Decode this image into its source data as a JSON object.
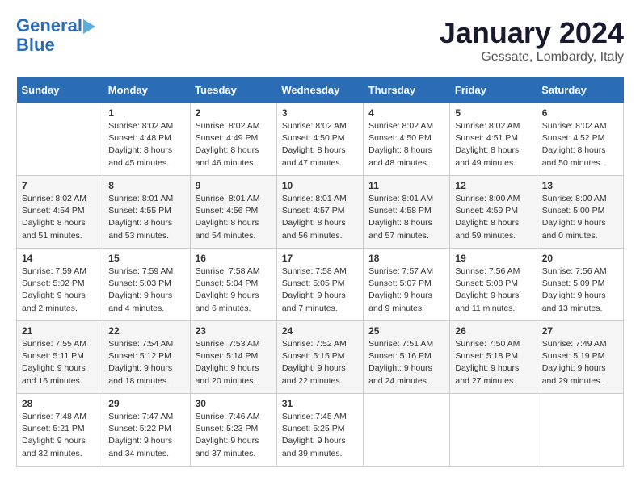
{
  "logo": {
    "line1": "General",
    "line2": "Blue"
  },
  "title": "January 2024",
  "subtitle": "Gessate, Lombardy, Italy",
  "headers": [
    "Sunday",
    "Monday",
    "Tuesday",
    "Wednesday",
    "Thursday",
    "Friday",
    "Saturday"
  ],
  "weeks": [
    [
      {
        "day": "",
        "sunrise": "",
        "sunset": "",
        "daylight": ""
      },
      {
        "day": "1",
        "sunrise": "Sunrise: 8:02 AM",
        "sunset": "Sunset: 4:48 PM",
        "daylight": "Daylight: 8 hours and 45 minutes."
      },
      {
        "day": "2",
        "sunrise": "Sunrise: 8:02 AM",
        "sunset": "Sunset: 4:49 PM",
        "daylight": "Daylight: 8 hours and 46 minutes."
      },
      {
        "day": "3",
        "sunrise": "Sunrise: 8:02 AM",
        "sunset": "Sunset: 4:50 PM",
        "daylight": "Daylight: 8 hours and 47 minutes."
      },
      {
        "day": "4",
        "sunrise": "Sunrise: 8:02 AM",
        "sunset": "Sunset: 4:50 PM",
        "daylight": "Daylight: 8 hours and 48 minutes."
      },
      {
        "day": "5",
        "sunrise": "Sunrise: 8:02 AM",
        "sunset": "Sunset: 4:51 PM",
        "daylight": "Daylight: 8 hours and 49 minutes."
      },
      {
        "day": "6",
        "sunrise": "Sunrise: 8:02 AM",
        "sunset": "Sunset: 4:52 PM",
        "daylight": "Daylight: 8 hours and 50 minutes."
      }
    ],
    [
      {
        "day": "7",
        "sunrise": "Sunrise: 8:02 AM",
        "sunset": "Sunset: 4:54 PM",
        "daylight": "Daylight: 8 hours and 51 minutes."
      },
      {
        "day": "8",
        "sunrise": "Sunrise: 8:01 AM",
        "sunset": "Sunset: 4:55 PM",
        "daylight": "Daylight: 8 hours and 53 minutes."
      },
      {
        "day": "9",
        "sunrise": "Sunrise: 8:01 AM",
        "sunset": "Sunset: 4:56 PM",
        "daylight": "Daylight: 8 hours and 54 minutes."
      },
      {
        "day": "10",
        "sunrise": "Sunrise: 8:01 AM",
        "sunset": "Sunset: 4:57 PM",
        "daylight": "Daylight: 8 hours and 56 minutes."
      },
      {
        "day": "11",
        "sunrise": "Sunrise: 8:01 AM",
        "sunset": "Sunset: 4:58 PM",
        "daylight": "Daylight: 8 hours and 57 minutes."
      },
      {
        "day": "12",
        "sunrise": "Sunrise: 8:00 AM",
        "sunset": "Sunset: 4:59 PM",
        "daylight": "Daylight: 8 hours and 59 minutes."
      },
      {
        "day": "13",
        "sunrise": "Sunrise: 8:00 AM",
        "sunset": "Sunset: 5:00 PM",
        "daylight": "Daylight: 9 hours and 0 minutes."
      }
    ],
    [
      {
        "day": "14",
        "sunrise": "Sunrise: 7:59 AM",
        "sunset": "Sunset: 5:02 PM",
        "daylight": "Daylight: 9 hours and 2 minutes."
      },
      {
        "day": "15",
        "sunrise": "Sunrise: 7:59 AM",
        "sunset": "Sunset: 5:03 PM",
        "daylight": "Daylight: 9 hours and 4 minutes."
      },
      {
        "day": "16",
        "sunrise": "Sunrise: 7:58 AM",
        "sunset": "Sunset: 5:04 PM",
        "daylight": "Daylight: 9 hours and 6 minutes."
      },
      {
        "day": "17",
        "sunrise": "Sunrise: 7:58 AM",
        "sunset": "Sunset: 5:05 PM",
        "daylight": "Daylight: 9 hours and 7 minutes."
      },
      {
        "day": "18",
        "sunrise": "Sunrise: 7:57 AM",
        "sunset": "Sunset: 5:07 PM",
        "daylight": "Daylight: 9 hours and 9 minutes."
      },
      {
        "day": "19",
        "sunrise": "Sunrise: 7:56 AM",
        "sunset": "Sunset: 5:08 PM",
        "daylight": "Daylight: 9 hours and 11 minutes."
      },
      {
        "day": "20",
        "sunrise": "Sunrise: 7:56 AM",
        "sunset": "Sunset: 5:09 PM",
        "daylight": "Daylight: 9 hours and 13 minutes."
      }
    ],
    [
      {
        "day": "21",
        "sunrise": "Sunrise: 7:55 AM",
        "sunset": "Sunset: 5:11 PM",
        "daylight": "Daylight: 9 hours and 16 minutes."
      },
      {
        "day": "22",
        "sunrise": "Sunrise: 7:54 AM",
        "sunset": "Sunset: 5:12 PM",
        "daylight": "Daylight: 9 hours and 18 minutes."
      },
      {
        "day": "23",
        "sunrise": "Sunrise: 7:53 AM",
        "sunset": "Sunset: 5:14 PM",
        "daylight": "Daylight: 9 hours and 20 minutes."
      },
      {
        "day": "24",
        "sunrise": "Sunrise: 7:52 AM",
        "sunset": "Sunset: 5:15 PM",
        "daylight": "Daylight: 9 hours and 22 minutes."
      },
      {
        "day": "25",
        "sunrise": "Sunrise: 7:51 AM",
        "sunset": "Sunset: 5:16 PM",
        "daylight": "Daylight: 9 hours and 24 minutes."
      },
      {
        "day": "26",
        "sunrise": "Sunrise: 7:50 AM",
        "sunset": "Sunset: 5:18 PM",
        "daylight": "Daylight: 9 hours and 27 minutes."
      },
      {
        "day": "27",
        "sunrise": "Sunrise: 7:49 AM",
        "sunset": "Sunset: 5:19 PM",
        "daylight": "Daylight: 9 hours and 29 minutes."
      }
    ],
    [
      {
        "day": "28",
        "sunrise": "Sunrise: 7:48 AM",
        "sunset": "Sunset: 5:21 PM",
        "daylight": "Daylight: 9 hours and 32 minutes."
      },
      {
        "day": "29",
        "sunrise": "Sunrise: 7:47 AM",
        "sunset": "Sunset: 5:22 PM",
        "daylight": "Daylight: 9 hours and 34 minutes."
      },
      {
        "day": "30",
        "sunrise": "Sunrise: 7:46 AM",
        "sunset": "Sunset: 5:23 PM",
        "daylight": "Daylight: 9 hours and 37 minutes."
      },
      {
        "day": "31",
        "sunrise": "Sunrise: 7:45 AM",
        "sunset": "Sunset: 5:25 PM",
        "daylight": "Daylight: 9 hours and 39 minutes."
      },
      {
        "day": "",
        "sunrise": "",
        "sunset": "",
        "daylight": ""
      },
      {
        "day": "",
        "sunrise": "",
        "sunset": "",
        "daylight": ""
      },
      {
        "day": "",
        "sunrise": "",
        "sunset": "",
        "daylight": ""
      }
    ]
  ]
}
